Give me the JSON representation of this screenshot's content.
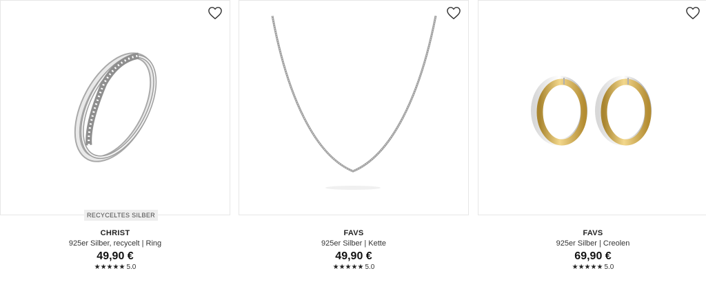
{
  "icons": {
    "wishlist": "heart-outline-icon",
    "star": "star-icon"
  },
  "colors": {
    "badge_bg": "#eeeeee",
    "text": "#222222",
    "star": "#222222"
  },
  "products": [
    {
      "badge": "RECYCELTES SILBER",
      "brand": "CHRIST",
      "desc": "925er Silber, recycelt | Ring",
      "price": "49,90 €",
      "stars": "★★★★★",
      "rating": "5.0"
    },
    {
      "brand": "FAVS",
      "desc": "925er Silber | Kette",
      "price": "49,90 €",
      "stars": "★★★★★",
      "rating": "5.0"
    },
    {
      "brand": "FAVS",
      "desc": "925er Silber | Creolen",
      "price": "69,90 €",
      "stars": "★★★★★",
      "rating": "5.0"
    }
  ]
}
